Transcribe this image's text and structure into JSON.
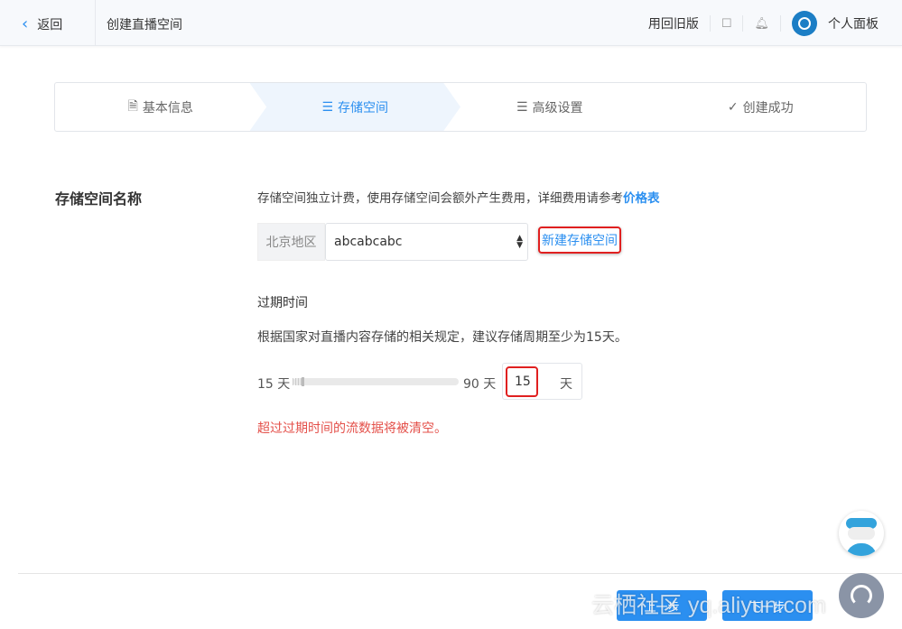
{
  "header": {
    "back_label": "返回",
    "title": "创建直播空间",
    "old_version": "用回旧版",
    "profile": "个人面板"
  },
  "steps": [
    {
      "label": "基本信息",
      "icon": "doc"
    },
    {
      "label": "存储空间",
      "icon": "list",
      "active": true
    },
    {
      "label": "高级设置",
      "icon": "list"
    },
    {
      "label": "创建成功",
      "icon": "check-circle"
    }
  ],
  "form": {
    "section_label": "存储空间名称",
    "description": "存储空间独立计费，使用存储空间会额外产生费用，详细费用请参考",
    "price_link": "价格表",
    "region": "北京地区",
    "bucket_value": "abcabcabc",
    "new_bucket": "新建存储空间",
    "expire_title": "过期时间",
    "expire_note": "根据国家对直播内容存储的相关规定，建议存储周期至少为15天。",
    "slider_min": "15 天",
    "slider_max": "90 天",
    "slider_value_fraction": 0,
    "days_value": "15",
    "days_unit": "天",
    "warning": "超过过期时间的流数据将被清空。",
    "warning_color": "#e4504a"
  },
  "footer": {
    "prev": "上一步",
    "next": "下一步"
  },
  "watermark": "云栖社区 yq.aliyun.com",
  "accent": "#2b8ff0"
}
